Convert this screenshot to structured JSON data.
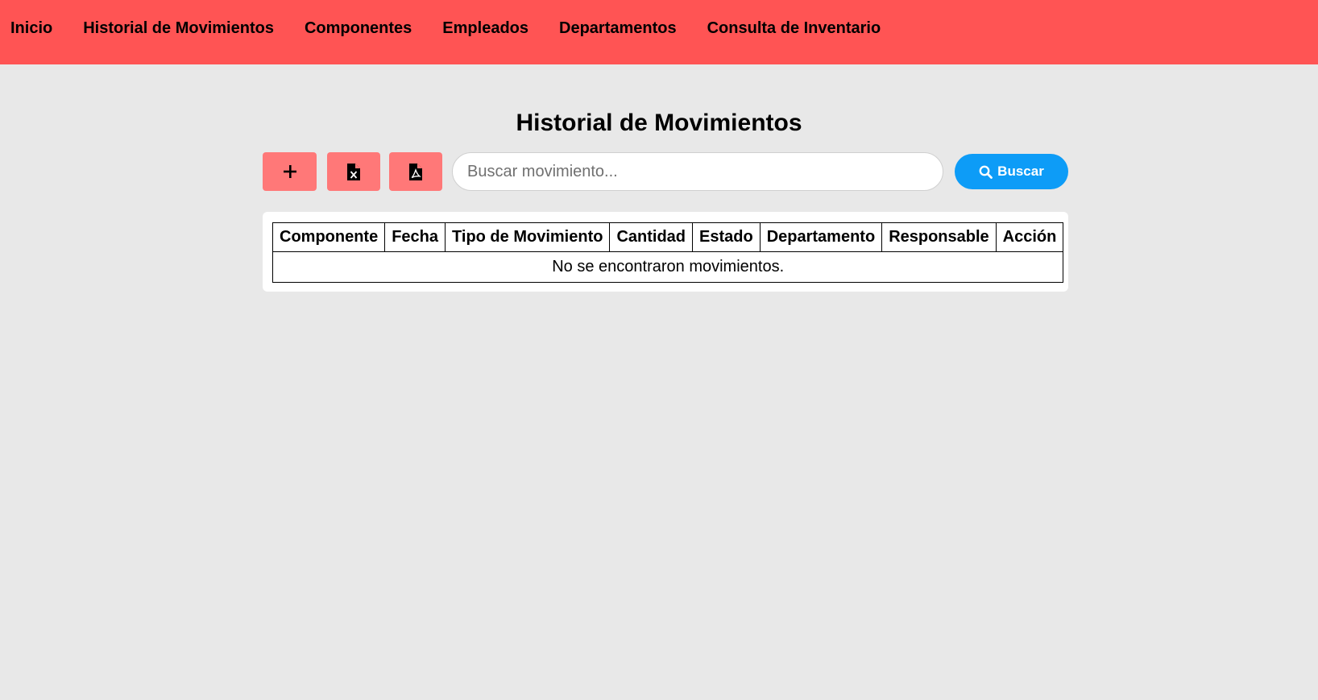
{
  "nav": {
    "items": [
      {
        "label": "Inicio"
      },
      {
        "label": "Historial de Movimientos"
      },
      {
        "label": "Componentes"
      },
      {
        "label": "Empleados"
      },
      {
        "label": "Departamentos"
      },
      {
        "label": "Consulta de Inventario"
      }
    ]
  },
  "page": {
    "title": "Historial de Movimientos"
  },
  "toolbar": {
    "add_icon": "plus-icon",
    "excel_icon": "file-excel-icon",
    "pdf_icon": "file-pdf-icon",
    "search_placeholder": "Buscar movimiento...",
    "search_value": "",
    "search_button_label": "Buscar",
    "search_icon": "search-icon"
  },
  "table": {
    "headers": [
      "Componente",
      "Fecha",
      "Tipo de Movimiento",
      "Cantidad",
      "Estado",
      "Departamento",
      "Responsable",
      "Acción"
    ],
    "empty_message": "No se encontraron movimientos."
  },
  "colors": {
    "navbar": "#ff5454",
    "tool_button": "#ff7878",
    "search_button": "#0d9cf7",
    "background": "#e8e8e8"
  }
}
